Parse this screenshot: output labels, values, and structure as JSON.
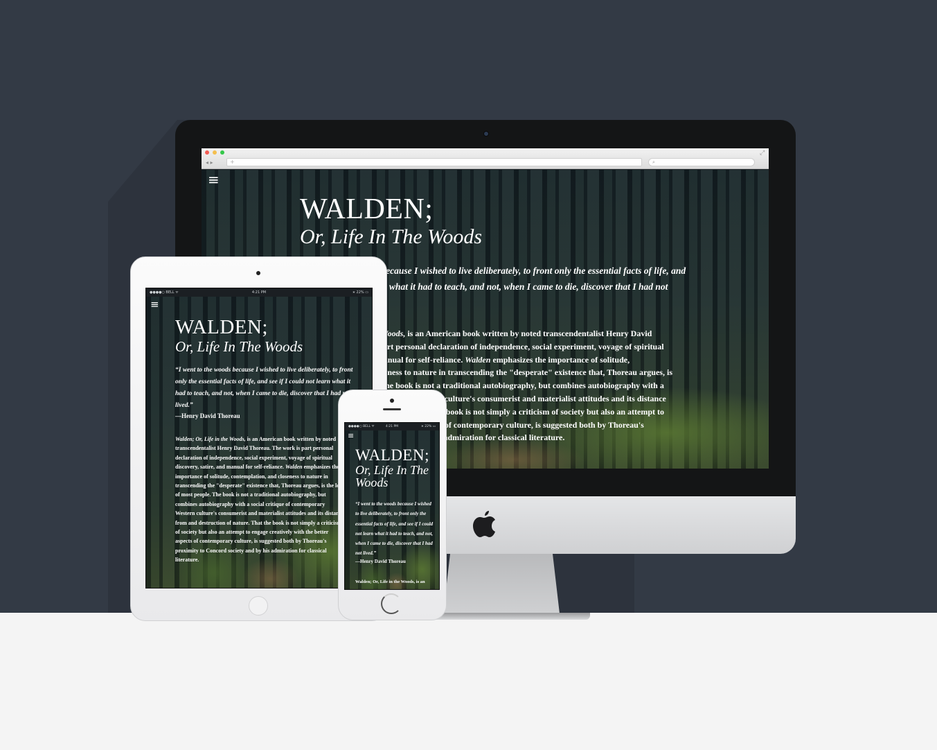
{
  "site": {
    "title_main": "WALDEN;",
    "title_sub": "Or, Life In The Woods",
    "quote": "“I went to the woods because I wished to live deliberately, to front only the essential facts of life, and see if I could not learn what it had to teach, and not, when I came to die, discover that I had not lived.”",
    "attribution": "—Henry David Thoreau",
    "body_lead": "Walden; Or, Life in the Woods,",
    "body_text": " is an American book written by noted transcendentalist Henry David Thoreau. The work is part personal declaration of independence, social experiment, voyage of spiritual discovery, satire, and manual for self-reliance. ",
    "body_em": "Walden",
    "body_text_2": " emphasizes the importance of solitude, contemplation, and closeness to nature in transcending the \"desperate\" existence that, Thoreau argues, is the lot of most people. The book is not a traditional autobiography, but combines autobiography with a social critique of contemporary Western culture's consumerist and materialist attitudes and its distance from and destruction of nature. That the book is not simply a criticism of society but also an attempt to engage creatively with the better aspects of contemporary culture, is suggested both by Thoreau's proximity to Concord society and by his admiration for classical literature.",
    "body_truncated": "Walden; Or, Life in the Woods, is an",
    "menu_icon": "≡"
  },
  "browser": {
    "back_forward": "◂ ▸",
    "address_plus": "+",
    "search_icon": "⌕",
    "expand_icon": "⤢"
  },
  "status_bar": {
    "carrier": "●●●●○ BELL ᯤ",
    "time": "4:21 PM",
    "battery": "∗ 22% ▭"
  },
  "colors": {
    "background": "#333a45",
    "floor": "#f4f4f4",
    "bezel": "#141516",
    "device_silver": "#e9e9eb"
  }
}
